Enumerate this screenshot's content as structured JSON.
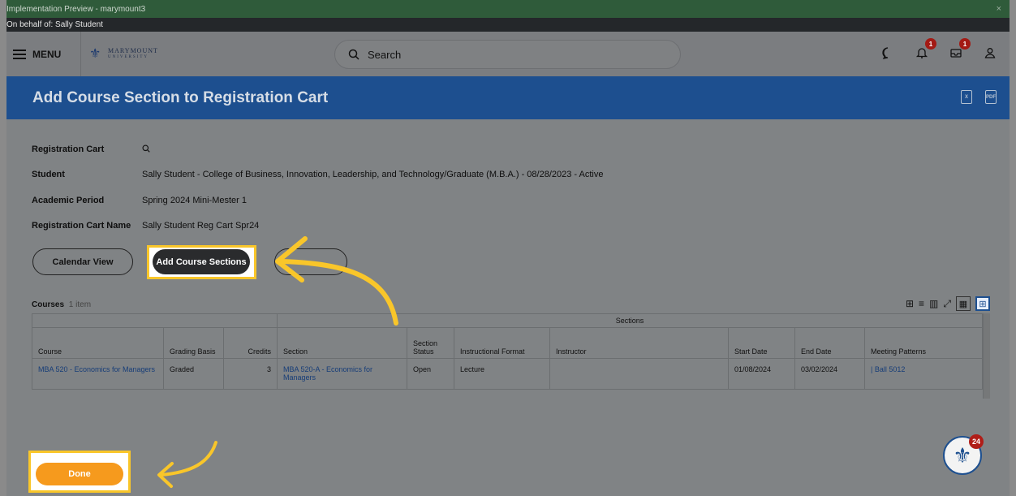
{
  "preview_bar": {
    "text": "Implementation Preview - marymount3",
    "close": "×"
  },
  "behalf_bar": {
    "text": "On behalf of: Sally Student"
  },
  "nav": {
    "menu_label": "MENU",
    "logo_name": "MARYMOUNT",
    "logo_sub": "UNIVERSITY",
    "search_placeholder": "Search",
    "notifications_count": "1",
    "inbox_count": "1"
  },
  "page": {
    "title": "Add Course Section to Registration Cart"
  },
  "fields": [
    {
      "label": "Registration Cart",
      "value": ""
    },
    {
      "label": "Student",
      "value": "Sally Student - College of Business, Innovation, Leadership, and Technology/Graduate (M.B.A.) - 08/28/2023 - Active"
    },
    {
      "label": "Academic Period",
      "value": "Spring 2024 Mini-Mester 1"
    },
    {
      "label": "Registration Cart Name",
      "value": "Sally Student Reg Cart Spr24"
    }
  ],
  "buttons": {
    "calendar_view": "Calendar View",
    "add_course_sections": "Add Course Sections",
    "done": "Done"
  },
  "courses": {
    "label": "Courses",
    "count": "1 item",
    "group_header": "Sections",
    "columns": [
      "Course",
      "Grading Basis",
      "Credits",
      "Section",
      "Section Status",
      "Instructional Format",
      "Instructor",
      "Start Date",
      "End Date",
      "Meeting Patterns"
    ],
    "rows": [
      {
        "course": "MBA 520 - Economics for Managers",
        "grading_basis": "Graded",
        "credits": "3",
        "section": "MBA 520-A - Economics for Managers",
        "status": "Open",
        "format": "Lecture",
        "instructor": "",
        "start": "01/08/2024",
        "end": "03/02/2024",
        "meeting": "| Ball 5012"
      }
    ]
  },
  "help_badge": "24",
  "colors": {
    "header": "#1d4f8f",
    "highlight": "#f9c62a",
    "done": "#f69a1d",
    "preview": "#2f5b3a"
  }
}
